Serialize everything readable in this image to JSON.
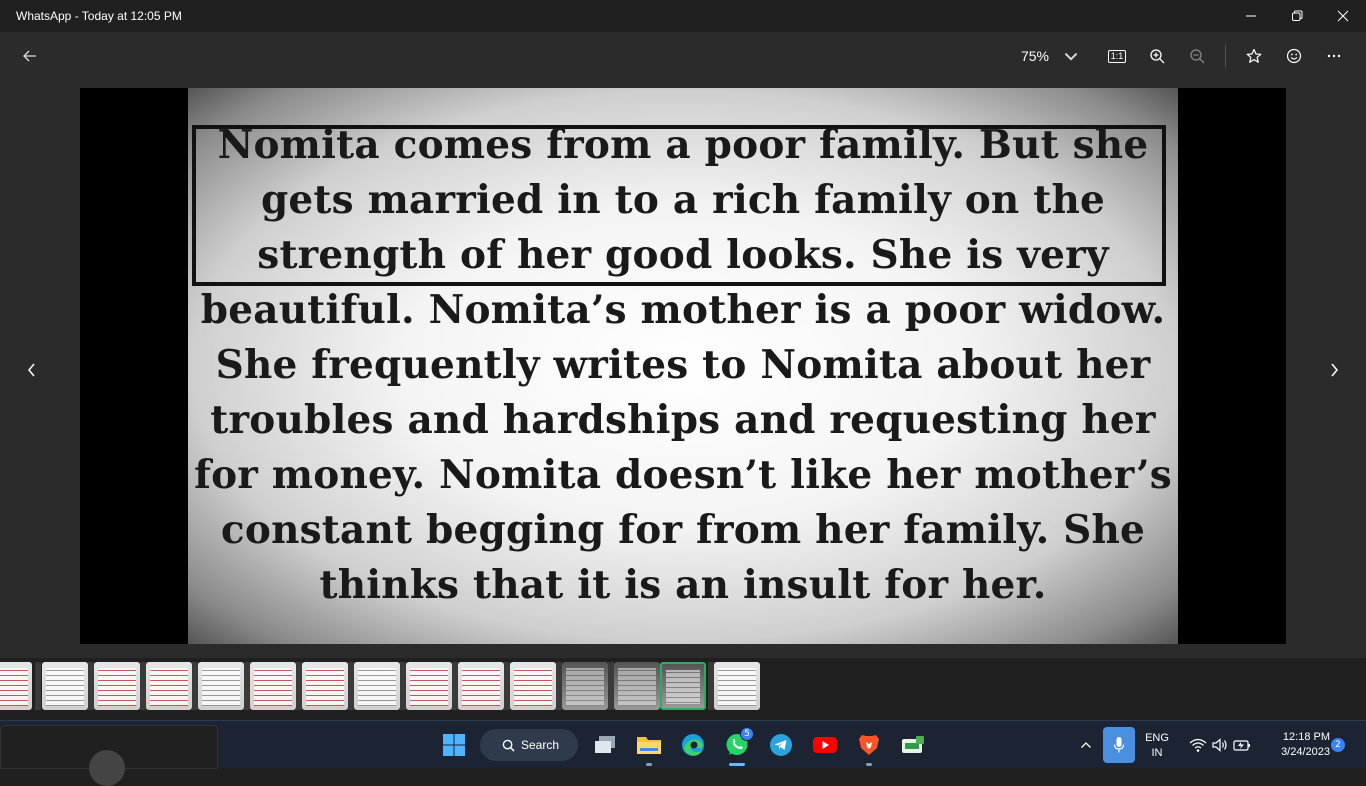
{
  "window": {
    "title": "WhatsApp - Today at 12:05 PM"
  },
  "toolbar": {
    "zoom": "75%",
    "one_to_one": "1:1"
  },
  "image": {
    "lines": [
      "Nomita comes from a poor family. But she",
      "gets married in to a rich family on the",
      "strength of her good looks. She is very",
      "beautiful. Nomita’s mother is a poor widow.",
      "She frequently writes to Nomita about her",
      "troubles and hardships and requesting her",
      "for money. Nomita doesn’t like her mother’s",
      "constant begging for from her family. She",
      "thinks that it is an insult for her."
    ]
  },
  "taskbar": {
    "search_label": "Search",
    "whatsapp_badge": "5",
    "language_top": "ENG",
    "language_bottom": "IN",
    "time": "12:18 PM",
    "date": "3/24/2023",
    "notification_count": "2"
  },
  "colors": {
    "titlebar_bg": "#202020",
    "toolbar_bg": "#2b2b2b",
    "taskbar_bg": "#1c2433",
    "accent": "#3b82f6",
    "selected_thumb": "#27ae60"
  }
}
